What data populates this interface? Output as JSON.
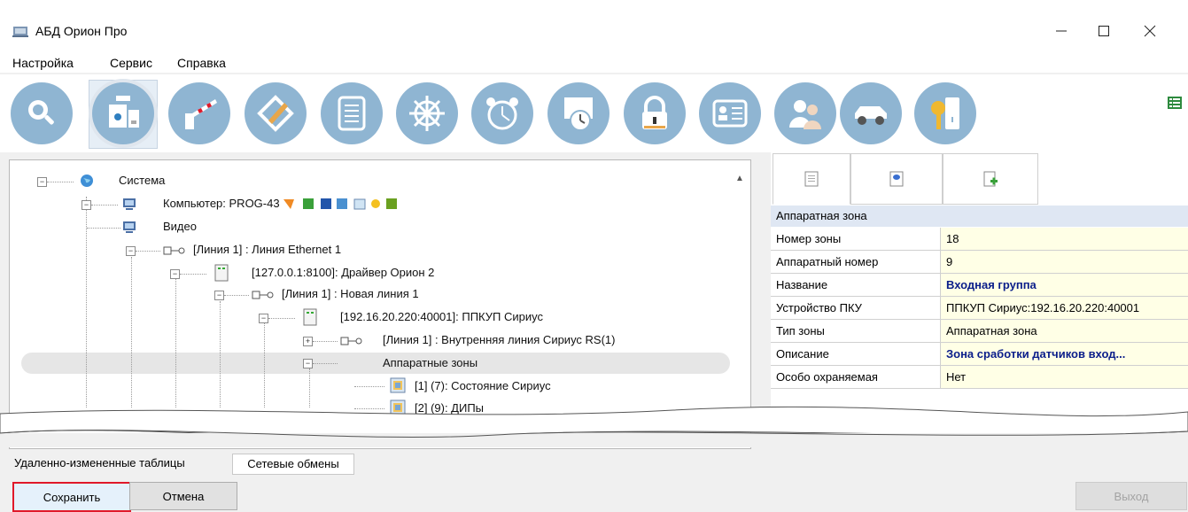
{
  "window": {
    "title": "АБД Орион Про",
    "controls": [
      "minimize",
      "maximize",
      "close"
    ]
  },
  "menu": [
    "Настройка",
    "Сервис",
    "Справка"
  ],
  "toolbar": {
    "buttons": [
      {
        "icon": "search-icon"
      },
      {
        "icon": "devices-icon",
        "selected": true
      },
      {
        "icon": "barrier-icon"
      },
      {
        "icon": "plan-edit-icon"
      },
      {
        "icon": "document-icon"
      },
      {
        "icon": "helm-icon"
      },
      {
        "icon": "alarm-clock-icon"
      },
      {
        "icon": "schedule-icon"
      },
      {
        "icon": "lock-icon"
      },
      {
        "icon": "card-icon"
      },
      {
        "icon": "users-icon"
      },
      {
        "icon": "car-icon"
      },
      {
        "icon": "key-icon"
      }
    ],
    "extra_icon": "list-view-icon"
  },
  "tree": {
    "nodes": [
      {
        "text": "Система"
      },
      {
        "text": "Компьютер: PROG-43"
      },
      {
        "text": "Видео"
      },
      {
        "text": "[Линия 1] : Линия Ethernet 1"
      },
      {
        "text": "[127.0.0.1:8100]: Драйвер Орион 2"
      },
      {
        "text": "[Линия 1] : Новая линия 1"
      },
      {
        "text": "[192.16.20.220:40001]: ППКУП Сириус"
      },
      {
        "text": "[Линия 1] : Внутренняя линия Сириус RS(1)"
      },
      {
        "text": "Аппаратные зоны",
        "selected": true
      },
      {
        "text": "[1] (7): Состояние Сириус"
      },
      {
        "text": "[2] (9): ДИПы"
      }
    ]
  },
  "properties": {
    "header": "Аппаратная зона",
    "rows": [
      {
        "label": "Номер зоны",
        "value": "18"
      },
      {
        "label": "Аппаратный номер",
        "value": "9"
      },
      {
        "label": "Название",
        "value": "Входная группа"
      },
      {
        "label": "Устройство ПКУ",
        "value": "ППКУП Сириус:192.16.20.220:40001"
      },
      {
        "label": "Тип зоны",
        "value": "Аппаратная зона"
      },
      {
        "label": "Описание",
        "value": "Зона сработки датчиков вход..."
      },
      {
        "label": "Особо охраняемая",
        "value": "Нет"
      }
    ]
  },
  "bottom_tabs": [
    "Удаленно-измененные таблицы",
    "Сетевые обмены"
  ],
  "buttons": {
    "save": "Сохранить",
    "cancel": "Отмена",
    "exit": "Выход"
  },
  "colors": {
    "accent_highlight": "#e0192a",
    "tool_circle": "#8fb5d2",
    "prop_value_bg": "#ffffe6",
    "prop_header_bg": "#dfe7f3",
    "bold_value": "#0a1d8a"
  }
}
